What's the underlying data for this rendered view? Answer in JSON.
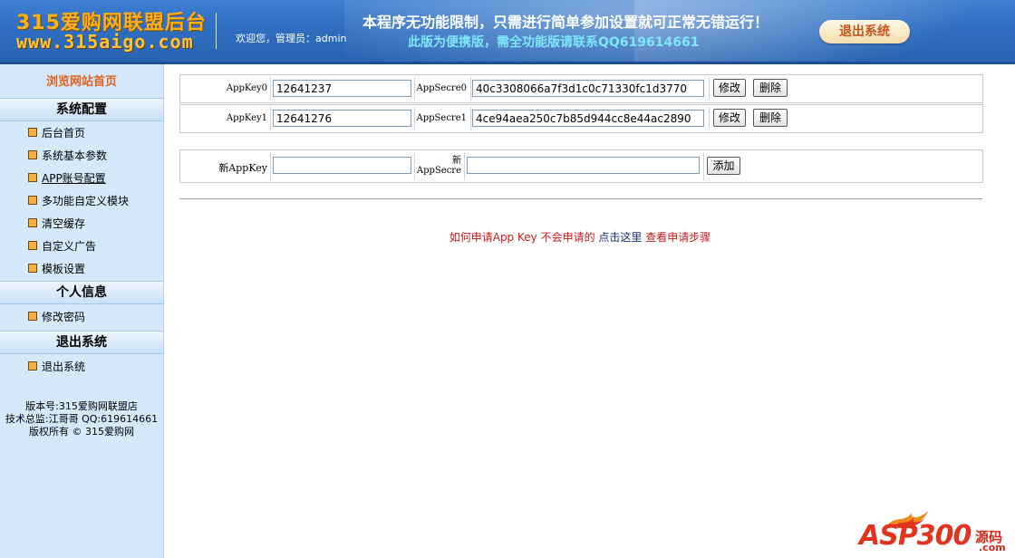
{
  "header": {
    "logo_line1": "315爱购网联盟后台",
    "logo_line2": "www.315aigo.com",
    "welcome": "欢迎您，管理员：admin",
    "notice_line1": "本程序无功能限制，只需进行简单参加设置就可正常无错运行！",
    "notice_line2": "此版为便携版，需全功能版请联系QQ619614661",
    "logout_label": "退出系统"
  },
  "sidebar": {
    "home_link": "浏览网站首页",
    "sections": [
      {
        "title": "系统配置",
        "items": [
          "后台首页",
          "系统基本参数",
          "APP账号配置",
          "多功能自定义模块",
          "清空缓存",
          "自定义广告",
          "模板设置"
        ]
      },
      {
        "title": "个人信息",
        "items": [
          "修改密码"
        ]
      },
      {
        "title": "退出系统",
        "items": [
          "退出系统"
        ]
      }
    ],
    "footer": {
      "version": "版本号:315爱购网联盟店",
      "tech": "技术总监:江哥哥 QQ:619614661",
      "copyright": "版权所有 © 315爱购网"
    }
  },
  "appkeys": [
    {
      "key_label": "AppKey0",
      "key_value": "12641237",
      "secret_label": "AppSecre0",
      "secret_value": "40c3308066a7f3d1c0c71330fc1d3770",
      "edit": "修改",
      "delete": "删除"
    },
    {
      "key_label": "AppKey1",
      "key_value": "12641276",
      "secret_label": "AppSecre1",
      "secret_value": "4ce94aea250c7b85d944cc8e44ac2890",
      "edit": "修改",
      "delete": "删除"
    }
  ],
  "new_key": {
    "key_label": "新AppKey",
    "secret_label_line1": "新",
    "secret_label_line2": "AppSecre",
    "key_value": "",
    "secret_value": "",
    "add": "添加"
  },
  "help": {
    "part1": "如何申请App Key 不会申请的",
    "part2": "点击这里",
    "part3": "查看申请步骤"
  },
  "watermark": {
    "brand": "ASP300",
    "cn": "源码",
    "com": ".com"
  },
  "colors": {
    "header_blue": "#2f6ec1",
    "sidebar_bg": "#d5e9fb",
    "home_link": "#e0611b",
    "help_red": "#c81a1a",
    "help_navy": "#1a2c7a"
  }
}
